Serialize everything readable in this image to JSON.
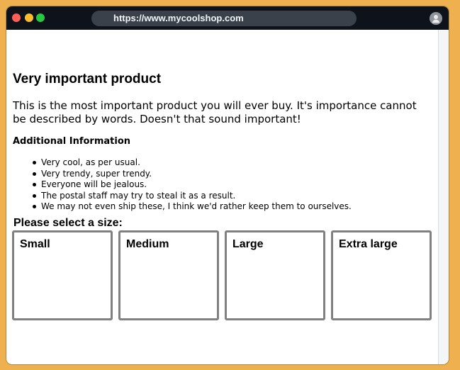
{
  "browser": {
    "url": "https://www.mycoolshop.com",
    "controls": [
      "close",
      "minimize",
      "zoom"
    ],
    "profile_icon": "user-icon"
  },
  "page": {
    "title": "Very important product",
    "description": "This is the most important product you will ever buy. It's importance cannot be described by words. Doesn't that sound important!",
    "additional_info": {
      "heading": "Additional Information",
      "items": [
        "Very cool, as per usual.",
        "Very trendy, super trendy.",
        "Everyone will be jealous.",
        "The postal staff may try to steal it as a result.",
        "We may not even ship these, I think we'd rather keep them to ourselves."
      ]
    },
    "size_selector": {
      "heading": "Please select a size:",
      "options": [
        "Small",
        "Medium",
        "Large",
        "Extra large"
      ]
    }
  },
  "colors": {
    "desktop_background": "#efb14f",
    "titlebar": "#0e131b",
    "urlbar": "#3b414b",
    "option_border": "#808080"
  }
}
